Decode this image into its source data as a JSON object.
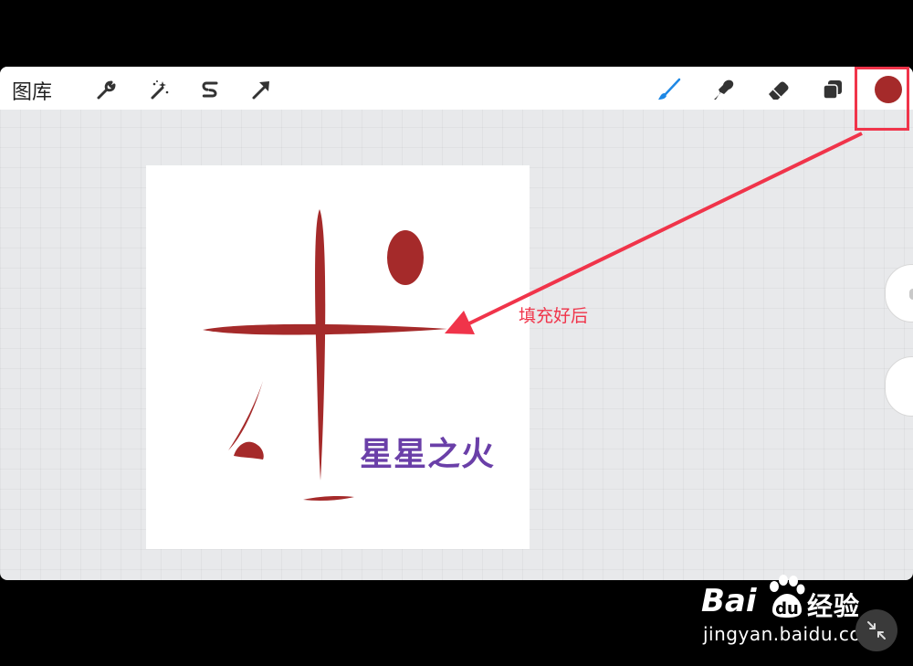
{
  "toolbar": {
    "gallery_label": "图库",
    "tools_left": [
      {
        "icon": "wrench-icon"
      },
      {
        "icon": "magic-wand-icon"
      },
      {
        "icon": "selection-s-icon"
      },
      {
        "icon": "transform-arrow-icon"
      }
    ],
    "tools_right": [
      {
        "icon": "brush-icon",
        "active": true
      },
      {
        "icon": "smudge-icon"
      },
      {
        "icon": "eraser-icon"
      },
      {
        "icon": "layers-icon"
      }
    ],
    "current_color": "#a52a2a"
  },
  "canvas": {
    "text": "星星之火",
    "text_color": "#6a3fa8",
    "stroke_color": "#a52a2a"
  },
  "annotation": {
    "label": "填充好后",
    "color": "#f0344a"
  },
  "watermark": {
    "logo_bai": "Bai",
    "logo_jingyan": "经验",
    "url": "jingyan.baidu.com"
  },
  "colors": {
    "active_tool": "#1e88e5",
    "toolbar_icon": "#333333",
    "highlight": "#f0344a"
  }
}
